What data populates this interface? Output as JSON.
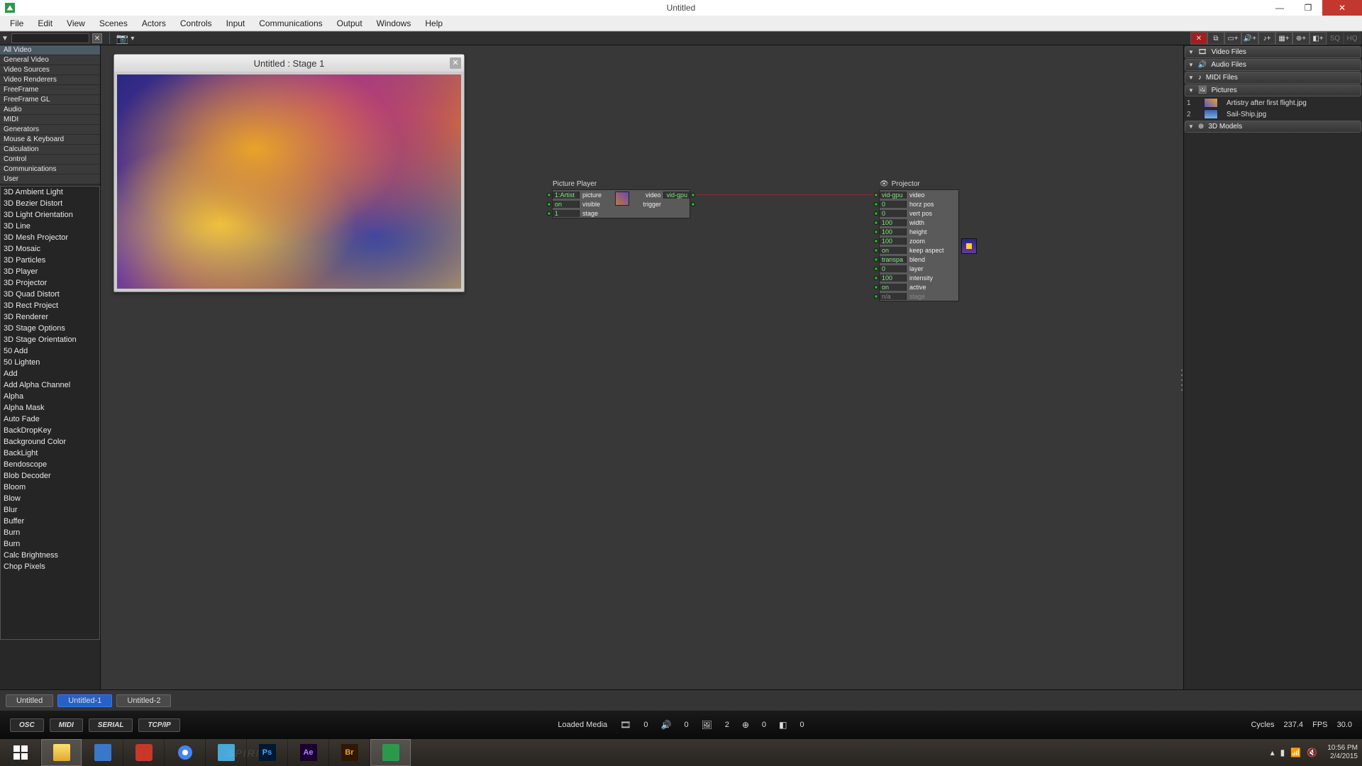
{
  "titlebar": {
    "title": "Untitled"
  },
  "menus": [
    "File",
    "Edit",
    "View",
    "Scenes",
    "Actors",
    "Controls",
    "Input",
    "Communications",
    "Output",
    "Windows",
    "Help"
  ],
  "categories": [
    {
      "label": "All Video",
      "selected": true
    },
    {
      "label": "General Video"
    },
    {
      "label": "Video Sources"
    },
    {
      "label": "Video Renderers"
    },
    {
      "label": "FreeFrame"
    },
    {
      "label": "FreeFrame GL"
    },
    {
      "label": "Audio"
    },
    {
      "label": "MIDI"
    },
    {
      "label": "Generators"
    },
    {
      "label": "Mouse & Keyboard"
    },
    {
      "label": "Calculation"
    },
    {
      "label": "Control"
    },
    {
      "label": "Communications"
    },
    {
      "label": "User"
    }
  ],
  "actors": [
    "3D Ambient Light",
    "3D Bezier Distort",
    "3D Light Orientation",
    "3D Line",
    "3D Mesh Projector",
    "3D Mosaic",
    "3D Particles",
    "3D Player",
    "3D Projector",
    "3D Quad Distort",
    "3D Rect Project",
    "3D Renderer",
    "3D Stage Options",
    "3D Stage Orientation",
    "50 Add",
    "50 Lighten",
    "Add",
    "Add Alpha Channel",
    "Alpha",
    "Alpha Mask",
    "Auto Fade",
    "BackDropKey",
    "Background Color",
    "BackLight",
    "Bendoscope",
    "Blob Decoder",
    "Bloom",
    "Blow",
    "Blur",
    "Buffer",
    "Burn",
    "Burn",
    "Calc Brightness",
    "Chop Pixels"
  ],
  "stage": {
    "title": "Untitled : Stage 1"
  },
  "node_picture": {
    "title": "Picture Player",
    "rows": [
      {
        "val": "1:Artist",
        "lbl": "picture"
      },
      {
        "val": "on",
        "lbl": "visible"
      },
      {
        "val": "1",
        "lbl": "stage"
      }
    ],
    "out": [
      {
        "lbl": "video",
        "val": "vid-gpu"
      },
      {
        "lbl": "trigger",
        "val": ""
      }
    ]
  },
  "node_projector": {
    "title": "Projector",
    "rows": [
      {
        "val": "vid-gpu",
        "lbl": "video"
      },
      {
        "val": "0",
        "lbl": "horz pos"
      },
      {
        "val": "0",
        "lbl": "vert pos"
      },
      {
        "val": "100",
        "lbl": "width"
      },
      {
        "val": "100",
        "lbl": "height"
      },
      {
        "val": "100",
        "lbl": "zoom"
      },
      {
        "val": "on",
        "lbl": "keep aspect"
      },
      {
        "val": "transpa",
        "lbl": "blend"
      },
      {
        "val": "0",
        "lbl": "layer"
      },
      {
        "val": "100",
        "lbl": "intensity"
      },
      {
        "val": "on",
        "lbl": "active"
      },
      {
        "val": "n/a",
        "lbl": "stage",
        "dim": true
      }
    ]
  },
  "media": {
    "groups": [
      "Video Files",
      "Audio Files",
      "MIDI Files",
      "Pictures",
      "3D Models"
    ],
    "pictures": [
      {
        "num": "1",
        "name": "Artistry after first flight.jpg"
      },
      {
        "num": "2",
        "name": "Sail-Ship.jpg"
      }
    ]
  },
  "scenes": [
    {
      "label": "Untitled",
      "active": false
    },
    {
      "label": "Untitled-1",
      "active": true
    },
    {
      "label": "Untitled-2",
      "active": false
    }
  ],
  "protocols": [
    "OSC",
    "MIDI",
    "SERIAL",
    "TCP/IP"
  ],
  "status": {
    "loaded_label": "Loaded Media",
    "v1": "0",
    "v2": "0",
    "v3": "2",
    "v4": "0",
    "v5": "0",
    "cycles_label": "Cycles",
    "cycles": "237.4",
    "fps_label": "FPS",
    "fps": "30.0"
  },
  "tray": {
    "time": "10:56 PM",
    "date": "2/4/2015"
  }
}
